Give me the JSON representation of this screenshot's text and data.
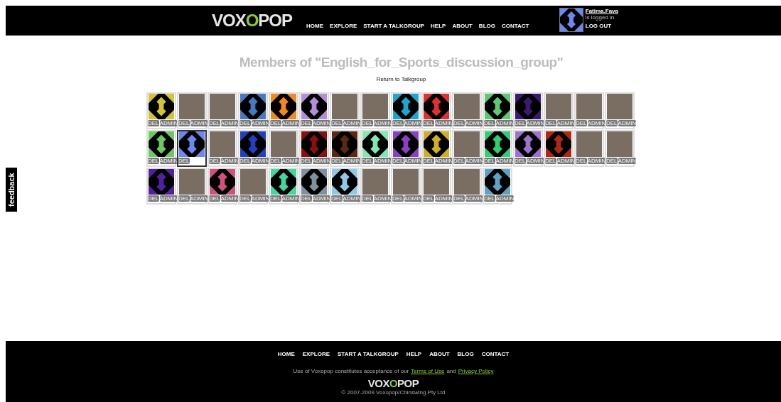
{
  "header": {
    "logo": "VOXOPOP",
    "nav": [
      "HOME",
      "EXPLORE",
      "START A TALKGROUP",
      "HELP",
      "ABOUT",
      "BLOG",
      "CONTACT"
    ],
    "user": {
      "name": "Fatima.Faya",
      "status": "is logged in",
      "logout": "LOG OUT"
    }
  },
  "title": "Members of \"English_for_Sports_discussion_group\"",
  "return_link": "Return to Talkgroup",
  "feedback": "feedback",
  "members": [
    {
      "kind": "pattern",
      "color": "#d4c23a",
      "selected": false,
      "buttons": [
        "DEL",
        "ADMIN"
      ]
    },
    {
      "kind": "photo",
      "selected": false,
      "buttons": [
        "DEL",
        "ADMIN"
      ]
    },
    {
      "kind": "photo",
      "selected": false,
      "buttons": [
        "DEL",
        "ADMIN"
      ]
    },
    {
      "kind": "pattern",
      "color": "#4a78c0",
      "selected": false,
      "buttons": [
        "DEL",
        "ADMIN"
      ]
    },
    {
      "kind": "pattern",
      "color": "#f08a1c",
      "selected": false,
      "buttons": [
        "DEL",
        "ADMIN"
      ]
    },
    {
      "kind": "pattern",
      "color": "#b48fd8",
      "selected": false,
      "buttons": [
        "DEL",
        "ADMIN"
      ]
    },
    {
      "kind": "photo",
      "selected": false,
      "buttons": [
        "DEL",
        "ADMIN"
      ]
    },
    {
      "kind": "photo",
      "selected": false,
      "buttons": [
        "DEL",
        "ADMIN"
      ]
    },
    {
      "kind": "pattern",
      "color": "#1aa8d0",
      "selected": false,
      "buttons": [
        "DEL",
        "ADMIN"
      ]
    },
    {
      "kind": "pattern",
      "color": "#e03030",
      "selected": false,
      "buttons": [
        "DEL",
        "ADMIN"
      ]
    },
    {
      "kind": "photo",
      "selected": false,
      "buttons": [
        "DEL",
        "ADMIN"
      ]
    },
    {
      "kind": "pattern",
      "color": "#5cc870",
      "selected": false,
      "buttons": [
        "DEL",
        "ADMIN"
      ]
    },
    {
      "kind": "pattern",
      "color": "#3a1a6e",
      "selected": false,
      "buttons": [
        "DEL",
        "ADMIN"
      ]
    },
    {
      "kind": "photo",
      "selected": false,
      "buttons": [
        "DEL",
        "ADMIN"
      ]
    },
    {
      "kind": "photo",
      "selected": false,
      "buttons": [
        "DEL",
        "ADMIN"
      ]
    },
    {
      "kind": "photo",
      "selected": false,
      "buttons": [
        "DEL",
        "ADMIN"
      ]
    },
    {
      "kind": "pattern",
      "color": "#6cc860",
      "selected": false,
      "buttons": [
        "DEL",
        "ADMIN"
      ]
    },
    {
      "kind": "pattern",
      "color": "#6a88f0",
      "selected": true,
      "buttons": [
        "DEL"
      ]
    },
    {
      "kind": "photo",
      "selected": false,
      "buttons": [
        "DEL",
        "ADMIN"
      ]
    },
    {
      "kind": "pattern",
      "color": "#2040c0",
      "selected": false,
      "buttons": [
        "DEL",
        "ADMIN"
      ]
    },
    {
      "kind": "photo",
      "selected": false,
      "buttons": [
        "DEL",
        "ADMIN"
      ]
    },
    {
      "kind": "pattern",
      "color": "#8a1010",
      "selected": false,
      "buttons": [
        "DEL",
        "ADMIN"
      ]
    },
    {
      "kind": "pattern",
      "color": "#5a2a10",
      "selected": false,
      "buttons": [
        "DEL",
        "ADMIN"
      ]
    },
    {
      "kind": "pattern",
      "color": "#80e8b0",
      "selected": false,
      "buttons": [
        "DEL",
        "ADMIN"
      ]
    },
    {
      "kind": "pattern",
      "color": "#8a40c0",
      "selected": false,
      "buttons": [
        "DEL",
        "ADMIN"
      ]
    },
    {
      "kind": "pattern",
      "color": "#d0b020",
      "selected": false,
      "buttons": [
        "DEL",
        "ADMIN"
      ]
    },
    {
      "kind": "photo",
      "selected": false,
      "buttons": [
        "DEL",
        "ADMIN"
      ]
    },
    {
      "kind": "pattern",
      "color": "#30d070",
      "selected": false,
      "buttons": [
        "DEL",
        "ADMIN"
      ]
    },
    {
      "kind": "pattern",
      "color": "#a070d0",
      "selected": false,
      "buttons": [
        "DEL",
        "ADMIN"
      ]
    },
    {
      "kind": "pattern",
      "color": "#b02810",
      "selected": false,
      "buttons": [
        "DEL",
        "ADMIN"
      ]
    },
    {
      "kind": "photo",
      "selected": false,
      "buttons": [
        "DEL",
        "ADMIN"
      ]
    },
    {
      "kind": "photo",
      "selected": false,
      "buttons": [
        "DEL",
        "ADMIN"
      ]
    },
    {
      "kind": "pattern",
      "color": "#5020a0",
      "selected": false,
      "buttons": [
        "DEL",
        "ADMIN"
      ]
    },
    {
      "kind": "photo",
      "selected": false,
      "buttons": [
        "DEL",
        "ADMIN"
      ]
    },
    {
      "kind": "pattern",
      "color": "#d05080",
      "selected": false,
      "buttons": [
        "DEL",
        "ADMIN"
      ]
    },
    {
      "kind": "photo",
      "selected": false,
      "buttons": [
        "DEL",
        "ADMIN"
      ]
    },
    {
      "kind": "pattern",
      "color": "#40d8a0",
      "selected": false,
      "buttons": [
        "DEL",
        "ADMIN"
      ]
    },
    {
      "kind": "pattern",
      "color": "#8090a0",
      "selected": false,
      "buttons": [
        "DEL",
        "ADMIN"
      ]
    },
    {
      "kind": "pattern",
      "color": "#90c8e8",
      "selected": false,
      "buttons": [
        "DEL",
        "ADMIN"
      ]
    },
    {
      "kind": "photo",
      "selected": false,
      "buttons": [
        "DEL",
        "ADMIN"
      ]
    },
    {
      "kind": "photo",
      "selected": false,
      "buttons": [
        "DEL",
        "ADMIN"
      ]
    },
    {
      "kind": "photo",
      "selected": false,
      "buttons": [
        "DEL",
        "ADMIN"
      ]
    },
    {
      "kind": "photo",
      "selected": false,
      "buttons": [
        "DEL",
        "ADMIN"
      ]
    },
    {
      "kind": "pattern",
      "color": "#60a0c0",
      "selected": false,
      "buttons": [
        "DEL",
        "ADMIN"
      ]
    }
  ],
  "footer": {
    "nav": [
      "HOME",
      "EXPLORE",
      "START A TALKGROUP",
      "HELP",
      "ABOUT",
      "BLOG",
      "CONTACT"
    ],
    "notice": {
      "text": "Use of Voxopop constitutes acceptance of our",
      "terms": "Terms of Use",
      "and": "and",
      "privacy": "Privacy Policy"
    },
    "logo": "VOXOPOP",
    "copyright": "© 2007-2009 Voxopop/Chinswing Pty Ltd"
  }
}
